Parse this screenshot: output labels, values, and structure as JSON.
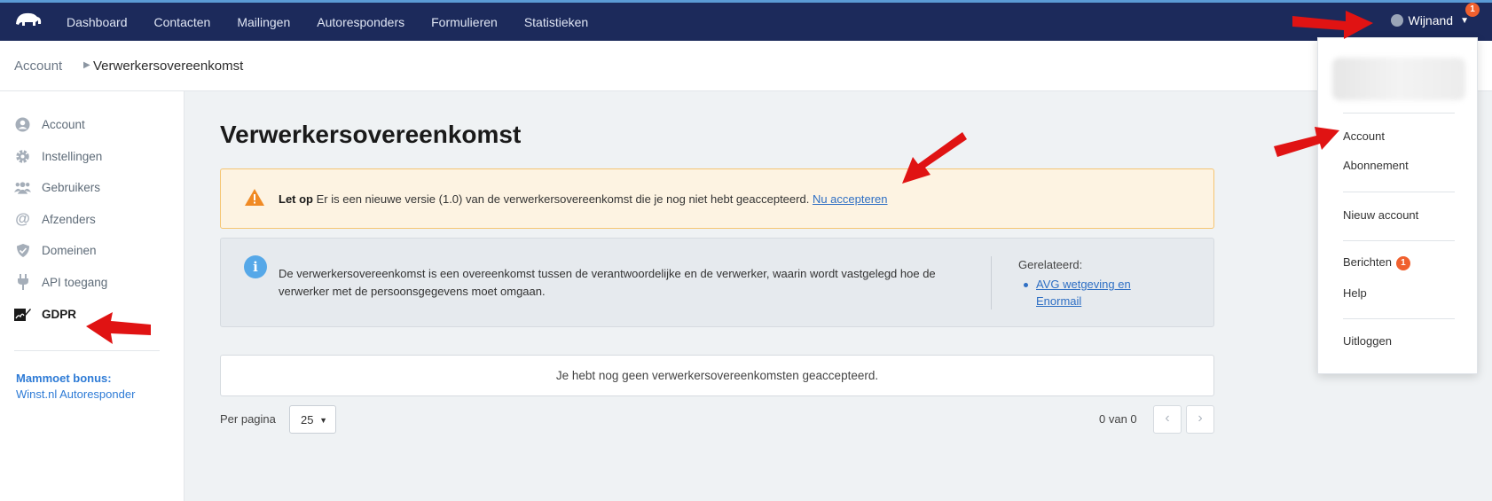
{
  "nav": {
    "items": [
      "Dashboard",
      "Contacten",
      "Mailingen",
      "Autoresponders",
      "Formulieren",
      "Statistieken"
    ],
    "user_name": "Wijnand",
    "notification_count": "1"
  },
  "breadcrumb": {
    "parent": "Account",
    "current": "Verwerkersovereenkomst"
  },
  "sidebar": {
    "items": [
      {
        "label": "Account",
        "icon": "user-circle-icon"
      },
      {
        "label": "Instellingen",
        "icon": "gear-icon"
      },
      {
        "label": "Gebruikers",
        "icon": "users-icon"
      },
      {
        "label": "Afzenders",
        "icon": "at-icon"
      },
      {
        "label": "Domeinen",
        "icon": "shield-icon"
      },
      {
        "label": "API toegang",
        "icon": "plug-icon"
      },
      {
        "label": "GDPR",
        "icon": "signature-icon"
      }
    ],
    "bonus_title": "Mammoet bonus:",
    "bonus_link": "Winst.nl Autoresponder"
  },
  "main": {
    "title": "Verwerkersovereenkomst",
    "warning": {
      "prefix": "Let op",
      "text": "Er is een nieuwe versie (1.0) van de verwerkersovereenkomst die je nog niet hebt geaccepteerd.",
      "link": "Nu accepteren"
    },
    "info": {
      "text": "De verwerkersovereenkomst is een overeenkomst tussen de verantwoordelijke en de verwerker, waarin wordt vastgelegd hoe de verwerker met de persoonsgegevens moet omgaan.",
      "related_label": "Gerelateerd:",
      "related_link": "AVG wetgeving en Enormail"
    },
    "empty_text": "Je hebt nog geen verwerkersovereenkomsten geaccepteerd.",
    "per_page_label": "Per pagina",
    "per_page_value": "25",
    "count_text": "0 van 0"
  },
  "dropdown": {
    "items": [
      "Account",
      "Abonnement",
      "Nieuw account",
      "Berichten",
      "Help",
      "Uitloggen"
    ],
    "messages_badge": "1"
  },
  "colors": {
    "nav_bg": "#1c2a5b",
    "accent": "#2e7bd6",
    "badge": "#f0602e",
    "arrow": "#e01313"
  }
}
